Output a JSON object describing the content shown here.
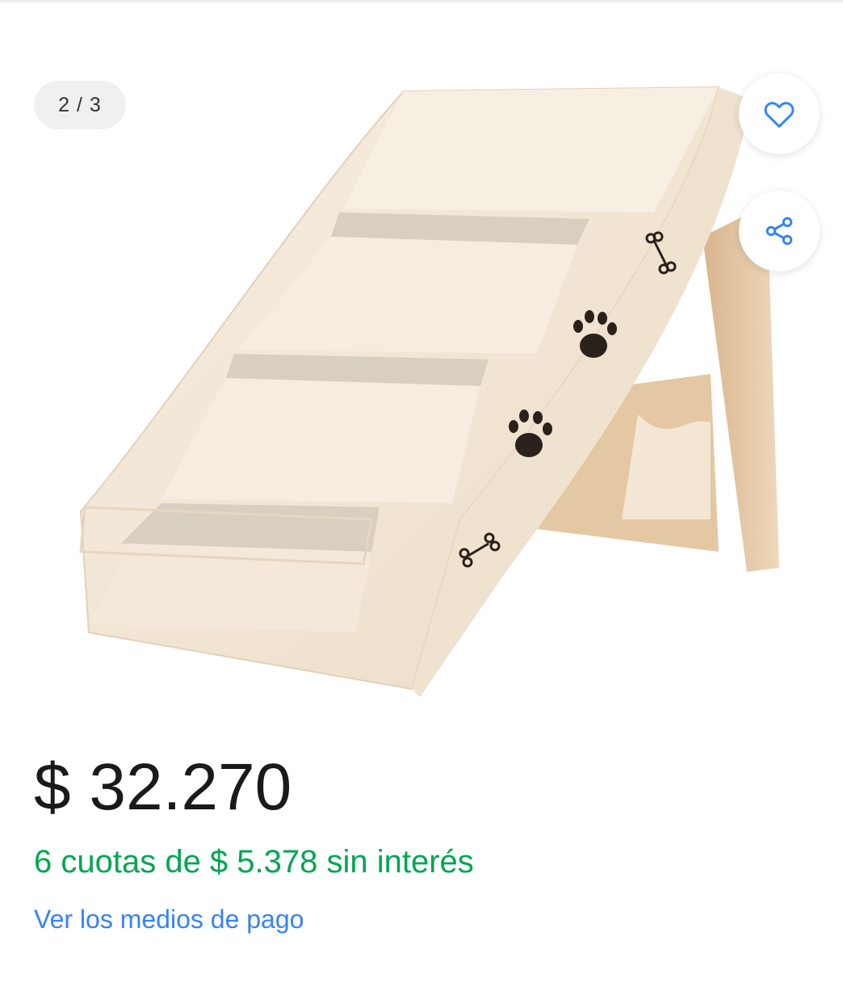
{
  "gallery": {
    "counter": "2 / 3",
    "image_name": "pet-stairs-photo"
  },
  "actions": {
    "favorite_icon": "heart-icon",
    "share_icon": "share-icon",
    "accent_color": "#3483fa"
  },
  "pricing": {
    "price": "$ 32.270",
    "installments": "6 cuotas de $ 5.378 sin interés",
    "installments_color": "#00a650",
    "payment_methods_link": "Ver los medios de pago"
  }
}
